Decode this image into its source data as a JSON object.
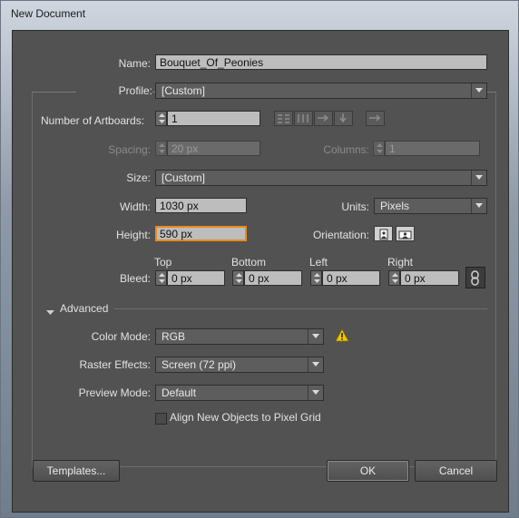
{
  "window": {
    "title": "New Document"
  },
  "name": {
    "label": "Name:",
    "value": "Bouquet_Of_Peonies"
  },
  "profile": {
    "label": "Profile:",
    "value": "[Custom]"
  },
  "artboards": {
    "label": "Number of Artboards:",
    "value": "1"
  },
  "spacing": {
    "label": "Spacing:",
    "value": "20 px"
  },
  "columns": {
    "label": "Columns:",
    "value": "1"
  },
  "size": {
    "label": "Size:",
    "value": "[Custom]"
  },
  "width": {
    "label": "Width:",
    "value": "1030 px"
  },
  "units": {
    "label": "Units:",
    "value": "Pixels"
  },
  "height": {
    "label": "Height:",
    "value": "590 px"
  },
  "orientation": {
    "label": "Orientation:"
  },
  "bleed": {
    "label": "Bleed:",
    "top": {
      "label": "Top",
      "value": "0 px"
    },
    "bottom": {
      "label": "Bottom",
      "value": "0 px"
    },
    "left": {
      "label": "Left",
      "value": "0 px"
    },
    "right": {
      "label": "Right",
      "value": "0 px"
    }
  },
  "advanced": {
    "label": "Advanced"
  },
  "color_mode": {
    "label": "Color Mode:",
    "value": "RGB"
  },
  "raster_effects": {
    "label": "Raster Effects:",
    "value": "Screen (72 ppi)"
  },
  "preview_mode": {
    "label": "Preview Mode:",
    "value": "Default"
  },
  "pixel_grid": {
    "label": "Align New Objects to Pixel Grid",
    "checked": false
  },
  "buttons": {
    "templates": "Templates...",
    "ok": "OK",
    "cancel": "Cancel"
  },
  "colors": {
    "warning": "#f2c400",
    "focus": "#e98a1d",
    "panel": "#525252"
  }
}
